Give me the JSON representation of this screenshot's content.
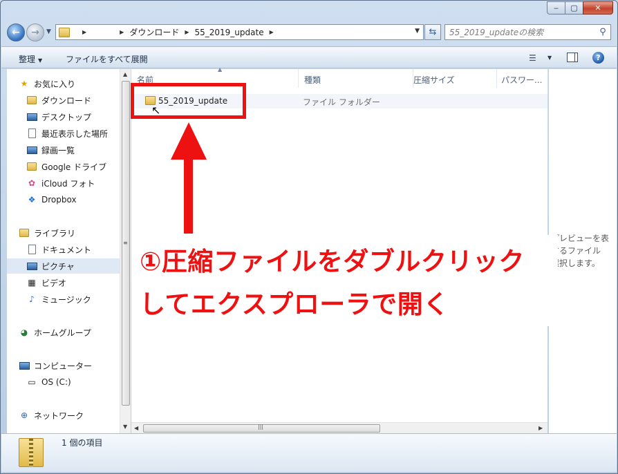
{
  "window": {
    "caption_min": "‒",
    "caption_max": "▢",
    "caption_close": "✕"
  },
  "address_bar": {
    "crumbs": [
      "ダウンロード",
      "55_2019_update"
    ],
    "search_placeholder": "55_2019_updateの検索"
  },
  "toolbar": {
    "organize": "整理",
    "extract_all": "ファイルをすべて展開",
    "help": "?"
  },
  "nav": {
    "favorites": "お気に入り",
    "downloads": "ダウンロード",
    "desktop": "デスクトップ",
    "recent": "最近表示した場所",
    "recordings": "録画一覧",
    "google_drive": "Google ドライブ",
    "icloud_photos": "iCloud フォト",
    "dropbox": "Dropbox",
    "libraries": "ライブラリ",
    "documents": "ドキュメント",
    "pictures": "ピクチャ",
    "videos": "ビデオ",
    "music": "ミュージック",
    "homegroup": "ホームグループ",
    "computer": "コンピューター",
    "os_drive": "OS (C:)",
    "network": "ネットワーク"
  },
  "columns": [
    "名前",
    "種類",
    "圧縮サイズ",
    "パスワー..."
  ],
  "files": [
    {
      "name": "55_2019_update",
      "type": "ファイル フォルダー"
    }
  ],
  "preview_text": "プレビューを表\nするファイル\n選択します。",
  "status": {
    "count": "1 個の項目"
  },
  "annotation": {
    "line1": "①圧縮ファイルをダブルクリック",
    "line2": "してエクスプローラで開く",
    "color": "#ee1111"
  }
}
